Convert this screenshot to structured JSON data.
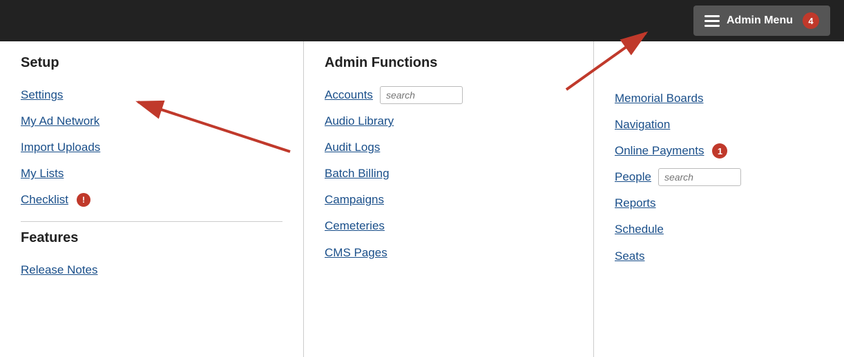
{
  "topbar": {
    "admin_menu_label": "Admin Menu",
    "admin_menu_badge": "4"
  },
  "setup": {
    "title": "Setup",
    "links": [
      {
        "label": "Settings",
        "badge": null
      },
      {
        "label": "My Ad Network",
        "badge": null
      },
      {
        "label": "Import Uploads",
        "badge": null
      },
      {
        "label": "My Lists",
        "badge": null
      },
      {
        "label": "Checklist",
        "badge": "!"
      }
    ],
    "features_title": "Features",
    "features_links": [
      {
        "label": "Release Notes",
        "badge": null
      }
    ]
  },
  "admin_functions": {
    "title": "Admin Functions",
    "links": [
      {
        "label": "Accounts",
        "search": true,
        "search_placeholder": "search"
      },
      {
        "label": "Audio Library",
        "search": false
      },
      {
        "label": "Audit Logs",
        "search": false
      },
      {
        "label": "Batch Billing",
        "search": false
      },
      {
        "label": "Campaigns",
        "search": false
      },
      {
        "label": "Cemeteries",
        "search": false
      },
      {
        "label": "CMS Pages",
        "search": false
      }
    ]
  },
  "right_col": {
    "links": [
      {
        "label": "Memorial Boards",
        "search": false,
        "badge": null
      },
      {
        "label": "Navigation",
        "search": false,
        "badge": null
      },
      {
        "label": "Online Payments",
        "search": false,
        "badge": "1"
      },
      {
        "label": "People",
        "search": true,
        "search_placeholder": "search",
        "badge": null
      },
      {
        "label": "Reports",
        "search": false,
        "badge": null
      },
      {
        "label": "Schedule",
        "search": false,
        "badge": null
      },
      {
        "label": "Seats",
        "search": false,
        "badge": null
      }
    ]
  }
}
